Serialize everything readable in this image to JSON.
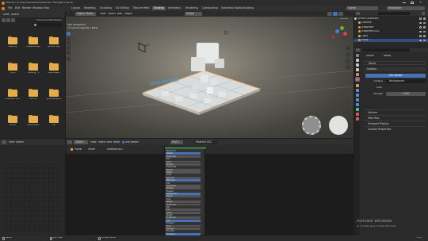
{
  "window": {
    "title": "Blender* [C:\\Users\\user\\Desktop\\blender files\\HyBrid.blend]",
    "scene_label": "Scene",
    "view_layer_label": "ViewLayer"
  },
  "menu": {
    "items": [
      "File",
      "Edit",
      "Render",
      "Window",
      "Help"
    ],
    "workspaces": [
      "Layout",
      "Modeling",
      "Sculpting",
      "UV Editing",
      "Texture Paint",
      "Shading",
      "Animation",
      "Rendering",
      "Compositing",
      "Geometry Nodes",
      "Scripting"
    ],
    "active_workspace": "Shading"
  },
  "file_browser": {
    "header": [
      "View",
      "Select"
    ],
    "path": "C:\\Users\\user\\Desktop\\blender files\\",
    "folders": [
      "KashiFiy",
      "AssetsModey",
      "Blender BDE",
      "Cloth",
      "Greatng - E",
      "Boilnheight",
      "Feedback Mon",
      "Github",
      "grade projects",
      "DINSB",
      "Shadpresent",
      "Old"
    ]
  },
  "viewport": {
    "header": [
      "Object Mode",
      "View",
      "Select",
      "Add",
      "Object"
    ],
    "transform": "Global",
    "info_line1": "User Perspective",
    "info_line2": "(1) Scene Collection | Plane",
    "options_label": "Options",
    "watermark": "JanLehWiD"
  },
  "outliner": {
    "rows": [
      "Scene Collection",
      "Camera",
      "Icosphere",
      "Icosphere.001",
      "Light",
      "Plane"
    ],
    "selected": 5
  },
  "properties": {
    "search_placeholder": "",
    "scene_label": "Scene",
    "world_label": "World",
    "world_name": "World",
    "surface_header": "Surface",
    "use_nodes": "Use Nodes",
    "surface_label": "Surface",
    "surface_value": "Background",
    "color_label": "Color",
    "strength_label": "Strength",
    "strength_value": "1.000",
    "panels": [
      "Volume",
      "Mist Pass",
      "Viewport Display",
      "Custom Properties"
    ],
    "accent": "#4772b3"
  },
  "node_editor": {
    "header": [
      "Object",
      "View",
      "Select",
      "Add",
      "Node",
      "Use Nodes"
    ],
    "breadcrumb": [
      "Plane",
      "Plane",
      "Material.002"
    ],
    "slot": "Slot 1",
    "material": "Material.002",
    "node_rows": [
      "Base Color",
      "Metallic",
      "Roughness",
      "IOR",
      "Alpha",
      "Normal",
      "Subsurface",
      "Weight",
      "Radius",
      "Scale",
      "Specular",
      "IOR Level",
      "Tint",
      "Anisotropic",
      "Rotation",
      "Tangent",
      "Transmission",
      "Weight",
      "Coat",
      "Weight",
      "Roughness",
      "IOR",
      "Tint",
      "Sheen",
      "Weight",
      "Roughness",
      "Tint",
      "Emission",
      "Color",
      "Strength",
      "Thin Film",
      "Thickness"
    ]
  },
  "bottom_left": {
    "header": [
      "View",
      "Select"
    ]
  },
  "status": {
    "left": "Select",
    "middle": "Pan View",
    "right": "Context Menu",
    "version": "4.2.1"
  },
  "activation": {
    "title": "Activate Windows",
    "subtitle": "Go to Settings to activate Windows."
  }
}
